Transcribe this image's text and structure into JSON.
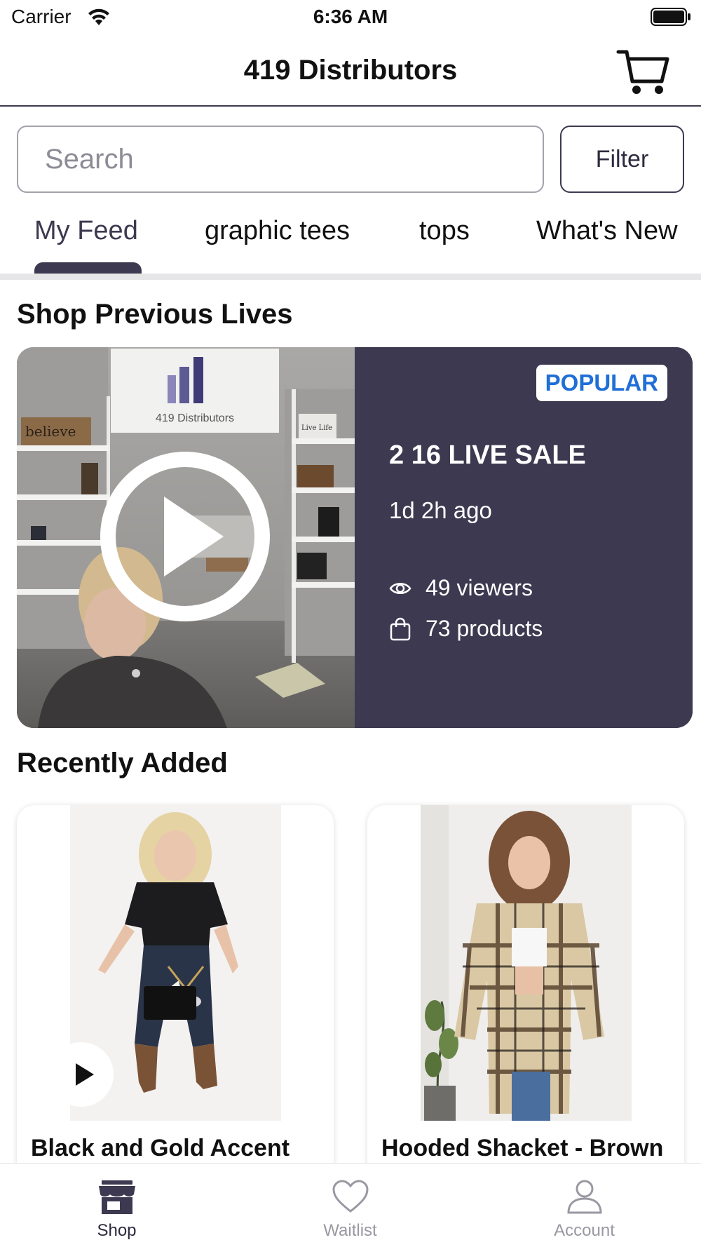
{
  "status_bar": {
    "carrier": "Carrier",
    "time": "6:36 AM"
  },
  "nav": {
    "title": "419 Distributors",
    "cart_icon": "cart-icon"
  },
  "search": {
    "placeholder": "Search",
    "filter_label": "Filter"
  },
  "tabs": [
    {
      "label": "My Feed",
      "active": true
    },
    {
      "label": "graphic tees",
      "active": false
    },
    {
      "label": "tops",
      "active": false
    },
    {
      "label": "What's New",
      "active": false
    }
  ],
  "sections": {
    "previous_lives": "Shop Previous Lives",
    "recently_added": "Recently Added"
  },
  "live": {
    "badge": "POPULAR",
    "title": "2 16 LIVE SALE",
    "ago": "1d 2h ago",
    "viewers": "49 viewers",
    "products": "73 products",
    "thumbnail_sign": "419 Distributors",
    "thumbnail_sign_left": "believe",
    "thumbnail_sign_right": "Live Life",
    "accent_color": "#3d3950",
    "badge_color": "#1f6fd6"
  },
  "products": [
    {
      "title": "Black and Gold Accent",
      "has_video": true
    },
    {
      "title": "Hooded Shacket - Brown",
      "has_video": false
    }
  ],
  "tab_bar": {
    "items": [
      {
        "label": "Shop",
        "icon": "shop-icon",
        "active": true
      },
      {
        "label": "Waitlist",
        "icon": "heart-icon",
        "active": false
      },
      {
        "label": "Account",
        "icon": "account-icon",
        "active": false
      }
    ]
  }
}
